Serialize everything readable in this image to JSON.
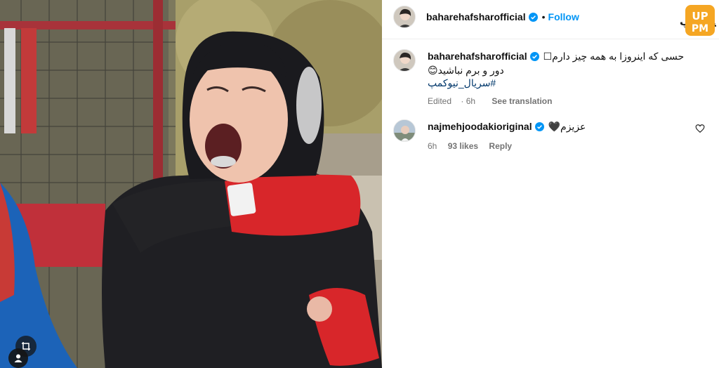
{
  "post": {
    "author": {
      "username": "baharehafsharofficial",
      "verified": true,
      "avatar_icon": "profile-photo"
    },
    "follow_label": "Follow",
    "separator": "•",
    "caption": {
      "line1": "حسی که اینروزا به همه چیز دارم☐",
      "line2": "دور و برم نباشید😊",
      "hashtag": "#سریال_نیوکمپ",
      "edited_label": "Edited",
      "time": "6h",
      "see_translation": "See translation"
    },
    "comments": [
      {
        "username": "najmehjoodakioriginal",
        "verified": true,
        "text": "عزیزم🖤",
        "time": "6h",
        "likes": "93 likes",
        "reply_label": "Reply",
        "like_icon": "heart-outline-icon"
      }
    ]
  },
  "watermark": {
    "brand_text": "پی ام آپ",
    "badge_text": "UP PM",
    "badge_color": "#f5a623"
  },
  "photo": {
    "description_icons": [
      "crop-icon",
      "user-tag-icon"
    ]
  },
  "colors": {
    "link_blue": "#0095f6",
    "hashtag_blue": "#00376b",
    "verified_blue": "#0095f6",
    "muted_text": "#737373"
  }
}
